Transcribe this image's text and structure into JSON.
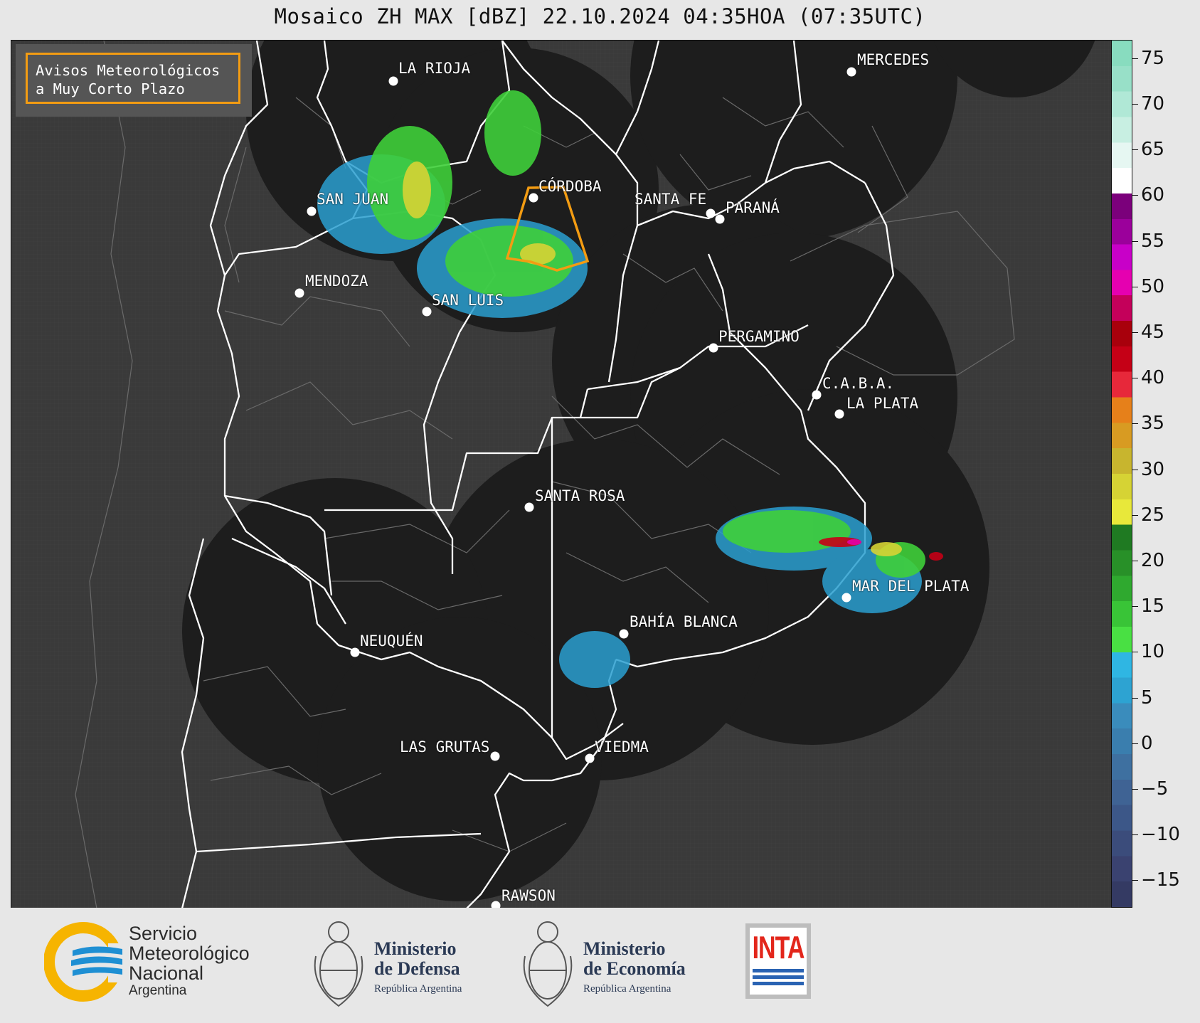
{
  "title": "Mosaico ZH MAX [dBZ] 22.10.2024 04:35HOA (07:35UTC)",
  "legend_box": {
    "line1": "Avisos Meteorológicos",
    "line2": "a Muy Corto Plazo"
  },
  "colorbar": {
    "min": -18,
    "max": 77,
    "ticks": [
      "75",
      "70",
      "65",
      "60",
      "55",
      "50",
      "45",
      "40",
      "35",
      "30",
      "25",
      "20",
      "15",
      "10",
      "5",
      "0",
      "−5",
      "−10",
      "−15"
    ],
    "tick_values": [
      75,
      70,
      65,
      60,
      55,
      50,
      45,
      40,
      35,
      30,
      25,
      20,
      15,
      10,
      5,
      0,
      -5,
      -10,
      -15
    ],
    "colors": [
      "#343a63",
      "#3a4270",
      "#3b4c7b",
      "#3c5788",
      "#3f6394",
      "#3e70a0",
      "#3a7eae",
      "#3a8cbc",
      "#2da3d2",
      "#2fb6e3",
      "#49e043",
      "#39c437",
      "#2fa92f",
      "#289028",
      "#1f7a22",
      "#e8e83a",
      "#d6d334",
      "#c8b52e",
      "#d89b22",
      "#e6801a",
      "#e7283a",
      "#c50016",
      "#a8000c",
      "#c4005a",
      "#e500b0",
      "#c800c8",
      "#9b009b",
      "#7b007b",
      "#ffffff",
      "#e6f7f2",
      "#c8efe2",
      "#b0e8d6",
      "#98e0c8",
      "#88dcbf"
    ]
  },
  "cities": [
    {
      "name": "LA RIOJA"
    },
    {
      "name": "SAN JUAN"
    },
    {
      "name": "CÓRDOBA"
    },
    {
      "name": "SANTA FE"
    },
    {
      "name": "PARANÁ"
    },
    {
      "name": "MENDOZA"
    },
    {
      "name": "SAN LUIS"
    },
    {
      "name": "MERCEDES"
    },
    {
      "name": "PERGAMINO"
    },
    {
      "name": "C.A.B.A."
    },
    {
      "name": "LA PLATA"
    },
    {
      "name": "SANTA ROSA"
    },
    {
      "name": "MAR DEL PLATA"
    },
    {
      "name": "BAHÍA BLANCA"
    },
    {
      "name": "NEUQUÉN"
    },
    {
      "name": "LAS GRUTAS"
    },
    {
      "name": "VIEDMA"
    },
    {
      "name": "RAWSON"
    }
  ],
  "footer": {
    "smn_line1": "Servicio",
    "smn_line2": "Meteorológico",
    "smn_line3": "Nacional",
    "smn_line4": "Argentina",
    "defensa_line1": "Ministerio",
    "defensa_line2": "de Defensa",
    "defensa_line3": "República Argentina",
    "economia_line1": "Ministerio",
    "economia_line2": "de Economía",
    "economia_line3": "República Argentina",
    "inta": "INTA"
  }
}
